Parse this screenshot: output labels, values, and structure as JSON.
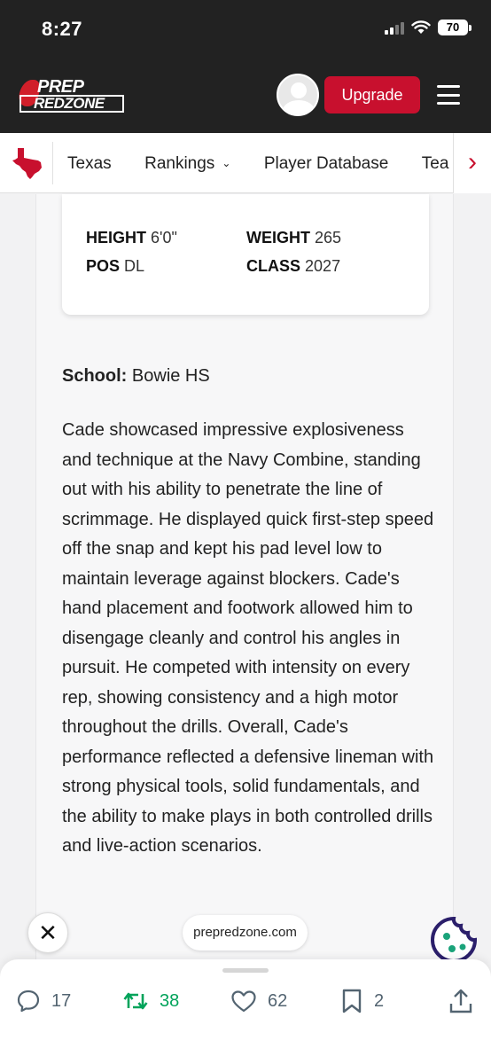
{
  "status_bar": {
    "time": "8:27",
    "battery": "70"
  },
  "header": {
    "logo_top": "PREP",
    "logo_bottom": "REDZONE",
    "upgrade_label": "Upgrade"
  },
  "nav": {
    "items": [
      {
        "label": "Texas"
      },
      {
        "label": "Rankings"
      },
      {
        "label": "Player Database"
      },
      {
        "label": "Tea"
      }
    ],
    "next_icon": "chevron-right-icon"
  },
  "player": {
    "height_label": "HEIGHT",
    "height_value": "6'0\"",
    "weight_label": "WEIGHT",
    "weight_value": "265",
    "pos_label": "POS",
    "pos_value": "DL",
    "class_label": "CLASS",
    "class_value": "2027"
  },
  "school": {
    "label": "School:",
    "value": "Bowie HS"
  },
  "description": "Cade showcased impressive explosiveness and technique at the Navy Combine, standing out with his ability to penetrate the line of scrimmage. He displayed quick first-step speed off the snap and kept his pad level low to maintain leverage against blockers. Cade's hand placement and footwork allowed him to disengage cleanly and control his angles in pursuit. He competed with intensity on every rep, showing consistency and a high motor throughout the drills. Overall, Cade's performance reflected a defensive lineman with strong physical tools, solid fundamentals, and the ability to make plays in both controlled drills and live-action scenarios.",
  "overlay": {
    "domain": "prepredzone.com",
    "close_icon": "close-icon",
    "cookie_icon": "cookie-icon"
  },
  "actions": {
    "replies": "17",
    "retweets": "38",
    "likes": "62",
    "bookmarks": "2"
  },
  "colors": {
    "brand_red": "#c8102e",
    "retweet_green": "#00a35a",
    "dark": "#222222"
  }
}
